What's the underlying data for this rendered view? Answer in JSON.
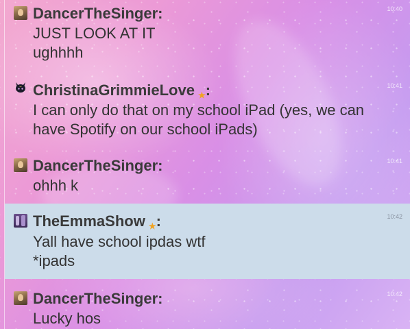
{
  "messages": [
    {
      "user": "DancerTheSinger",
      "time": "10:40",
      "avatar_icon": "dancer-avatar-icon",
      "lines": [
        "JUST LOOK AT IT",
        "ughhhh"
      ],
      "highlighted": false
    },
    {
      "user": "ChristinaGrimmieLove",
      "time": "10:41",
      "avatar_icon": "sailor-moon-cat-avatar-icon",
      "badge": "★",
      "lines": [
        "I can only do that on my school iPad (yes, we can",
        "have Spotify on our school iPads)"
      ],
      "highlighted": false
    },
    {
      "user": "DancerTheSinger",
      "time": "10:41",
      "avatar_icon": "dancer-avatar-icon",
      "lines": [
        "ohhh k"
      ],
      "highlighted": false
    },
    {
      "user": "TheEmmaShow",
      "time": "10:42",
      "avatar_icon": "emma-avatar-icon",
      "badge": "★",
      "lines": [
        "Yall have school ipdas wtf",
        "*ipads"
      ],
      "highlighted": true
    },
    {
      "user": "DancerTheSinger",
      "time": "10:42",
      "avatar_icon": "dancer-avatar-icon",
      "lines": [
        "Lucky hos"
      ],
      "highlighted": false
    }
  ],
  "colon": ":",
  "colors": {
    "highlight_bg": "#ccdcea",
    "username": "#3a3a3a",
    "message_text": "#333333",
    "star_badge": "#f2a31f"
  }
}
